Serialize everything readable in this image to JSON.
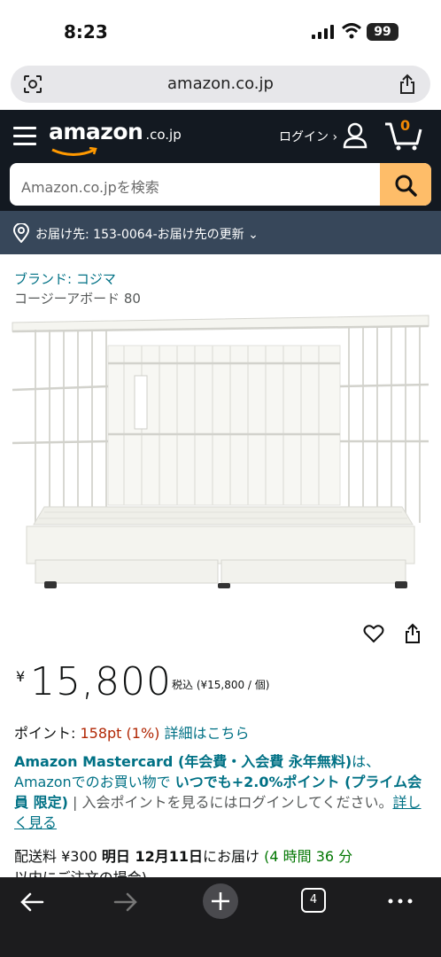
{
  "status_bar": {
    "time": "8:23",
    "battery": "99"
  },
  "browser": {
    "url": "amazon.co.jp",
    "tab_count": "4"
  },
  "header": {
    "logo_word": "amazon",
    "logo_tld": ".co.jp",
    "login_label": "ログイン ›",
    "cart_count": "0",
    "search_placeholder": "Amazon.co.jpを検索"
  },
  "delivery": {
    "text": "お届け先: 153-0064-お届け先の更新 ⌄"
  },
  "product": {
    "brand": "ブランド: コジマ",
    "title": "コージーアボード 80",
    "price_symbol": "¥",
    "price": "15,800",
    "tax_note": "税込 (¥15,800 / 個)",
    "points_label": "ポイント: ",
    "points_value": "158pt  (1%)",
    "points_link": "詳細はこちら"
  },
  "mastercard": {
    "part1": "Amazon Mastercard (年会費・入会費 永年無料)",
    "part2": "は、Amazonでのお買い物で ",
    "part3": "いつでも+2.0%ポイント (プライム会員 限定)",
    "part4": " | 入会ポイントを見るにはログインしてください。",
    "link": "詳しく見る"
  },
  "shipping": {
    "prefix": "配送料 ¥300 ",
    "date": "明日 12月11日",
    "middle": "にお届け ",
    "time_window": "(4 時間 36 分",
    "suffix": "以内にご注文の場合)"
  },
  "colors": {
    "header_bg": "#131921",
    "delivery_bg": "#37475a",
    "link": "#007185",
    "price_red": "#b12704",
    "search_button": "#febd69"
  }
}
